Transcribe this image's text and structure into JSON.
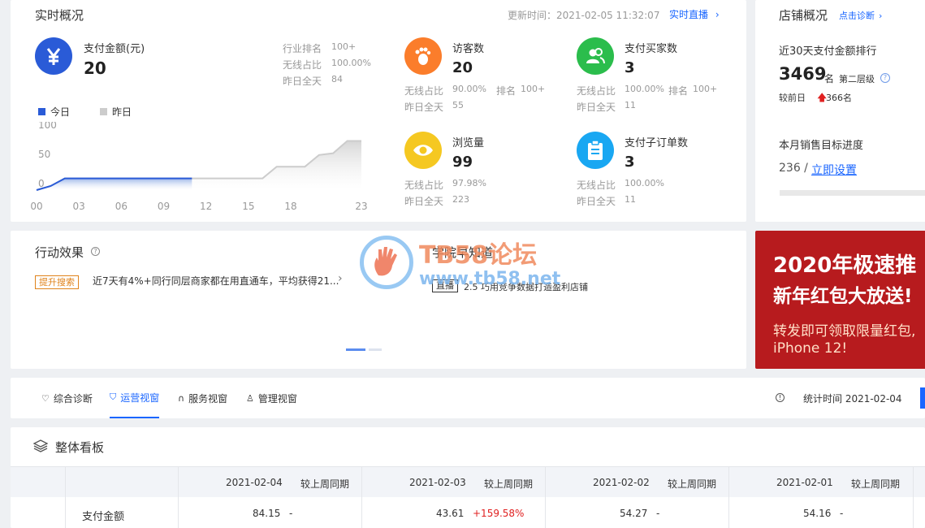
{
  "realtime": {
    "title": "实时概况",
    "update_label": "更新时间：2021-02-05 11:32:07",
    "live_link": "实时直播",
    "pay_amount": {
      "label": "支付金额(元)",
      "value": "20",
      "rank_label": "行业排名",
      "rank_value": "100+",
      "wireless_label": "无线占比",
      "wireless_value": "100.00%",
      "yesterday_label": "昨日全天",
      "yesterday_value": "84"
    },
    "legend_today": "今日",
    "legend_yesterday": "昨日",
    "colors": {
      "today": "#2a5bd7",
      "yesterday": "#cccccc"
    },
    "chart_data": {
      "type": "area",
      "y_ticks": [
        "100",
        "50",
        "0"
      ],
      "x_ticks": [
        "00",
        "03",
        "06",
        "09",
        "12",
        "15",
        "18",
        "23"
      ],
      "ylim": [
        0,
        100
      ],
      "series": [
        {
          "name": "今日",
          "x": [
            0,
            1,
            2,
            3,
            4,
            5,
            6,
            7,
            8,
            9,
            10,
            11
          ],
          "values": [
            0,
            7,
            20,
            20,
            20,
            20,
            20,
            20,
            20,
            20,
            20,
            20
          ]
        },
        {
          "name": "昨日",
          "x": [
            0,
            1,
            2,
            3,
            4,
            5,
            6,
            7,
            8,
            9,
            10,
            11,
            12,
            13,
            14,
            15,
            16,
            17,
            18,
            19,
            20,
            21,
            22,
            23
          ],
          "values": [
            0,
            7,
            20,
            20,
            20,
            20,
            20,
            20,
            20,
            20,
            20,
            20,
            20,
            20,
            20,
            20,
            20,
            40,
            40,
            40,
            60,
            63,
            84,
            84
          ]
        }
      ]
    },
    "stats": [
      {
        "label": "访客数",
        "value": "20",
        "icon": "footprint-icon",
        "color": "#fb7d2b",
        "l1": "无线占比",
        "v1": "90.00%",
        "l2": "排名",
        "v2": "100+",
        "l3": "昨日全天",
        "v3": "55"
      },
      {
        "label": "支付买家数",
        "value": "3",
        "icon": "users-icon",
        "color": "#2bbd4c",
        "l1": "无线占比",
        "v1": "100.00%",
        "l2": "排名",
        "v2": "100+",
        "l3": "昨日全天",
        "v3": "11"
      },
      {
        "label": "浏览量",
        "value": "99",
        "icon": "eye-icon",
        "color": "#f5c821",
        "l1": "无线占比",
        "v1": "97.98%",
        "l2": "",
        "v2": "",
        "l3": "昨日全天",
        "v3": "223"
      },
      {
        "label": "支付子订单数",
        "value": "3",
        "icon": "clipboard-icon",
        "color": "#19a7f2",
        "l1": "无线占比",
        "v1": "100.00%",
        "l2": "",
        "v2": "",
        "l3": "昨日全天",
        "v3": "11"
      }
    ]
  },
  "shop": {
    "title": "店铺概况",
    "diag_link": "点击诊断",
    "rank_title": "近30天支付金额排行",
    "rank_value": "3469",
    "rank_unit": "名",
    "level": "第二层级",
    "compare_label": "较前日",
    "compare_value": "366名",
    "target_title": "本月销售目标进度",
    "target_value": "236 /",
    "target_link": "立即设置"
  },
  "action": {
    "title": "行动效果",
    "tag": "提升搜索",
    "text": "近7天有4%+同行同层商家都在用直通车，平均获得21..."
  },
  "academy": {
    "title": "学院早知道",
    "tag": "直播",
    "text": "2.5 巧用竞争数据打造盈利店铺"
  },
  "watermark": {
    "title": "TB58论坛",
    "url": "www.tb58.net"
  },
  "banner": {
    "line1": "2020年极速推",
    "line2": "新年红包大放送!",
    "line3": "转发即可领取限量红包,",
    "line4": "iPhone 12!"
  },
  "tabs": {
    "items": [
      {
        "label": "综合诊断",
        "icon": "bulb-icon"
      },
      {
        "label": "运营视窗",
        "icon": "shield-icon"
      },
      {
        "label": "服务视窗",
        "icon": "headset-icon"
      },
      {
        "label": "管理视窗",
        "icon": "person-icon"
      }
    ],
    "stat_time": "统计时间 2021-02-04"
  },
  "board": {
    "title": "整体看板",
    "dates": [
      "2021-02-04",
      "2021-02-03",
      "2021-02-02",
      "2021-02-01"
    ],
    "compare_label": "较上周同期",
    "row_label": "支付金额",
    "values": [
      "84.15",
      "43.61",
      "54.27",
      "54.16"
    ],
    "changes": [
      "-",
      "+159.58%",
      "-",
      "-"
    ]
  }
}
